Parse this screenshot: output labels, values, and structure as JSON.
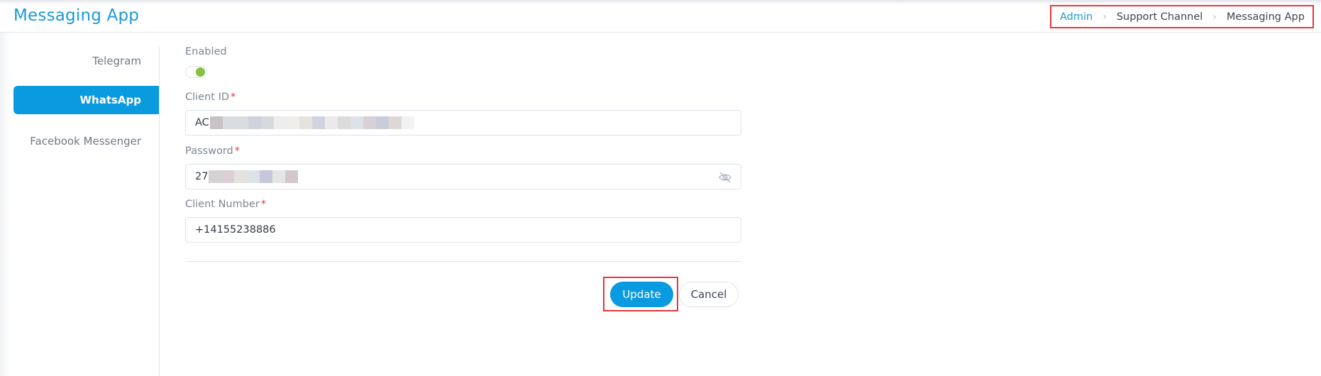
{
  "header": {
    "title": "Messaging App",
    "breadcrumb": [
      {
        "label": "Admin",
        "link": true
      },
      {
        "label": "Support Channel",
        "link": false
      },
      {
        "label": "Messaging App",
        "link": false
      }
    ],
    "separator_icon": "chevron-right-icon"
  },
  "sidebar": {
    "items": [
      {
        "label": "Telegram",
        "active": false
      },
      {
        "label": "WhatsApp",
        "active": true
      },
      {
        "label": "Facebook Messenger",
        "active": false
      }
    ]
  },
  "form": {
    "enabled": {
      "label": "Enabled",
      "value": true
    },
    "client_id": {
      "label": "Client ID",
      "required_mark": "*",
      "value_visible": "AC",
      "value_redacted": true
    },
    "password": {
      "label": "Password",
      "required_mark": "*",
      "value_visible": "27",
      "value_redacted": true,
      "toggle_icon": "eye-off-icon"
    },
    "client_number": {
      "label": "Client Number",
      "required_mark": "*",
      "value": "+14155238886"
    },
    "update_label": "Update",
    "cancel_label": "Cancel"
  },
  "colors": {
    "accent": "#0a9ae0",
    "title": "#1a9ad6",
    "toggle_on": "#86c140",
    "highlight": "#e8363d"
  }
}
